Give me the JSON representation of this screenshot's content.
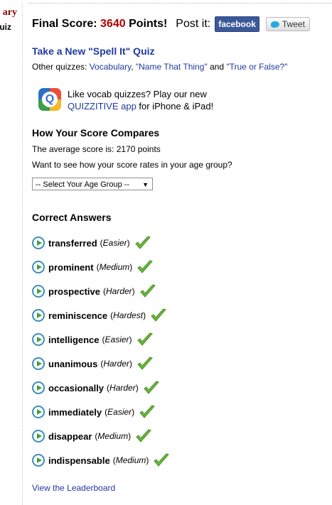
{
  "sidebar": {
    "title_fragment": "ary",
    "sub_fragment": "uiz"
  },
  "score": {
    "label": "Final Score:",
    "value": "3640",
    "suffix": "Points!",
    "post_label": "Post it:"
  },
  "share": {
    "facebook_label": "facebook",
    "tweet_label": "Tweet"
  },
  "new_quiz": {
    "title": "Take a New \"Spell It\" Quiz"
  },
  "other_quizzes": {
    "prefix": "Other quizzes: ",
    "link1": "Vocabulary",
    "sep1": ", ",
    "link2": "\"Name That Thing\"",
    "sep2": " and ",
    "link3": "\"True or False?\""
  },
  "promo": {
    "icon_letter": "Q",
    "line1": "Like vocab quizzes? Play our new",
    "link": "QUIZZITIVE app",
    "suffix": " for iPhone & iPad!"
  },
  "compare": {
    "heading": "How Your Score Compares",
    "average": "The average score is: 2170 points",
    "question": "Want to see how your score rates in your age group?",
    "select_value": "-- Select Your Age Group --"
  },
  "correct": {
    "heading": "Correct Answers",
    "items": [
      {
        "word": "transferred",
        "difficulty": "Easier"
      },
      {
        "word": "prominent",
        "difficulty": "Medium"
      },
      {
        "word": "prospective",
        "difficulty": "Harder"
      },
      {
        "word": "reminiscence",
        "difficulty": "Hardest"
      },
      {
        "word": "intelligence",
        "difficulty": "Easier"
      },
      {
        "word": "unanimous",
        "difficulty": "Harder"
      },
      {
        "word": "occasionally",
        "difficulty": "Harder"
      },
      {
        "word": "immediately",
        "difficulty": "Easier"
      },
      {
        "word": "disappear",
        "difficulty": "Medium"
      },
      {
        "word": "indispensable",
        "difficulty": "Medium"
      }
    ]
  },
  "leaderboard": {
    "label": "View the Leaderboard"
  },
  "colors": {
    "accent_red": "#b00000",
    "link_blue": "#1f3a9e",
    "facebook": "#3b5998",
    "check_green": "#6ab83e"
  },
  "icons": [
    "play-icon",
    "checkmark-icon",
    "twitter-bird-icon",
    "quizzitive-app-icon",
    "dropdown-arrow-icon"
  ]
}
